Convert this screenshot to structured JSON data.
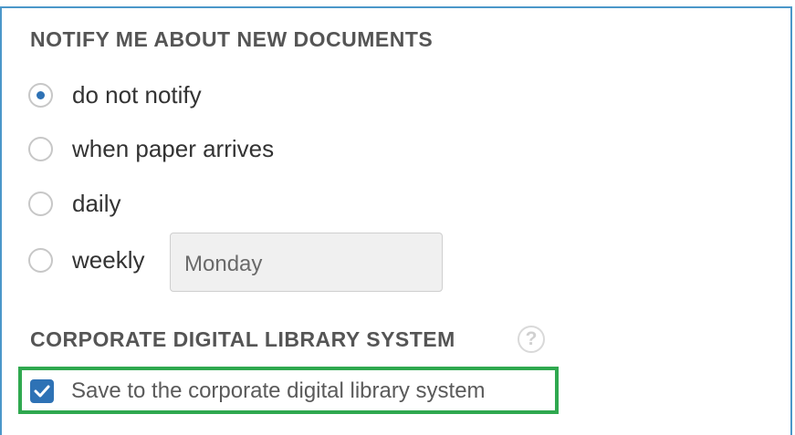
{
  "notify": {
    "title": "NOTIFY ME ABOUT NEW DOCUMENTS",
    "options": [
      {
        "label": "do not notify",
        "checked": true
      },
      {
        "label": "when paper arrives",
        "checked": false
      },
      {
        "label": "daily",
        "checked": false
      },
      {
        "label": "weekly",
        "checked": false
      }
    ],
    "weekly_day_value": "Monday"
  },
  "cdls": {
    "title": "CORPORATE DIGITAL LIBRARY SYSTEM",
    "help_glyph": "?",
    "checkbox_label": "Save to the corporate digital library system",
    "checkbox_checked": true
  },
  "colors": {
    "accent": "#2e72b5",
    "panel_border": "#4b97c9",
    "highlight": "#2fa84f"
  }
}
